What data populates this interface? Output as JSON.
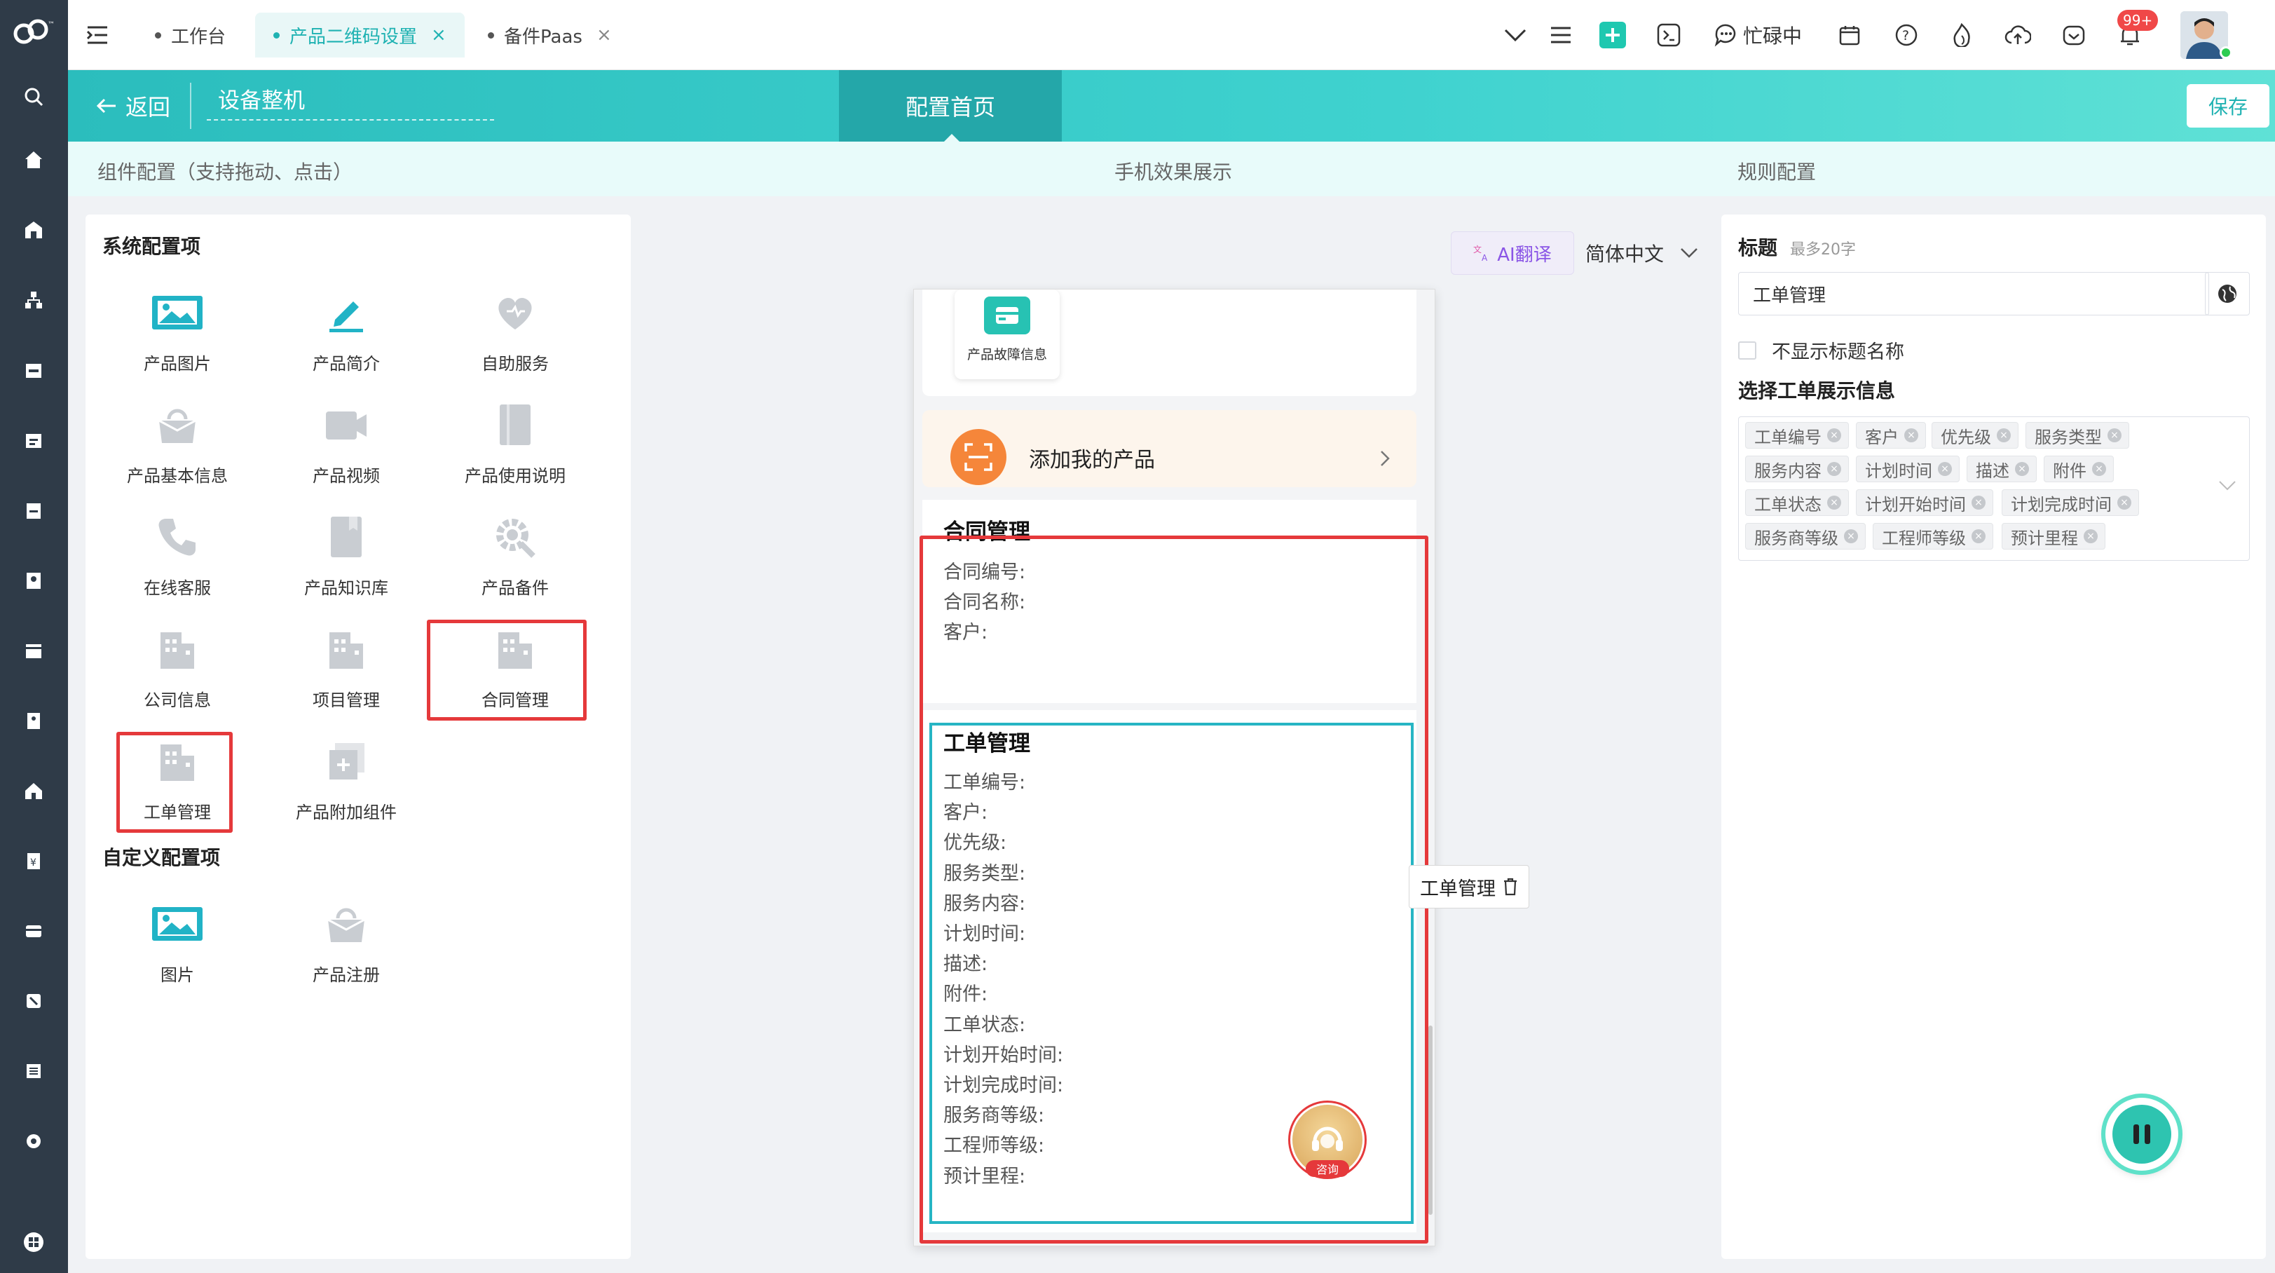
{
  "tabs": [
    {
      "label": "工作台",
      "active": false,
      "closable": false
    },
    {
      "label": "产品二维码设置",
      "active": true,
      "closable": true
    },
    {
      "label": "备件Paas",
      "active": false,
      "closable": true
    }
  ],
  "topbar": {
    "status_label": "忙碌中",
    "notification_badge": "99+",
    "close_glyph": "×"
  },
  "header": {
    "back_label": "返回",
    "page_name": "设备整机",
    "active_tab": "配置首页",
    "save_label": "保存"
  },
  "subheader": {
    "left": "组件配置（支持拖动、点击）",
    "center": "手机效果展示",
    "right": "规则配置"
  },
  "left_panel": {
    "system_title": "系统配置项",
    "system_items": [
      {
        "label": "产品图片",
        "icon": "image-icon"
      },
      {
        "label": "产品简介",
        "icon": "pen-icon"
      },
      {
        "label": "自助服务",
        "icon": "heart-icon"
      },
      {
        "label": "产品基本信息",
        "icon": "bag-icon"
      },
      {
        "label": "产品视频",
        "icon": "video-icon"
      },
      {
        "label": "产品使用说明",
        "icon": "document-icon"
      },
      {
        "label": "在线客服",
        "icon": "phone-icon"
      },
      {
        "label": "产品知识库",
        "icon": "book-icon"
      },
      {
        "label": "产品备件",
        "icon": "gear-icon"
      },
      {
        "label": "公司信息",
        "icon": "building-icon"
      },
      {
        "label": "项目管理",
        "icon": "building-icon"
      },
      {
        "label": "合同管理",
        "icon": "building-icon"
      },
      {
        "label": "工单管理",
        "icon": "building-icon"
      },
      {
        "label": "产品附加组件",
        "icon": "add-component-icon"
      }
    ],
    "custom_title": "自定义配置项",
    "custom_items": [
      {
        "label": "图片",
        "icon": "image-icon"
      },
      {
        "label": "产品注册",
        "icon": "bag-icon"
      }
    ]
  },
  "preview": {
    "ai_translate_label": "AI翻译",
    "language_label": "简体中文",
    "fault_info_label": "产品故障信息",
    "add_product_label": "添加我的产品",
    "contract": {
      "title": "合同管理",
      "fields": [
        "合同编号:",
        "合同名称:",
        "客户:"
      ]
    },
    "work_order": {
      "title": "工单管理",
      "fields": [
        "工单编号:",
        "客户:",
        "优先级:",
        "服务类型:",
        "服务内容:",
        "计划时间:",
        "描述:",
        "附件:",
        "工单状态:",
        "计划开始时间:",
        "计划完成时间:",
        "服务商等级:",
        "工程师等级:",
        "预计里程:"
      ]
    },
    "consult_label": "咨询",
    "floating_label": "工单管理"
  },
  "right_panel": {
    "title_label": "标题",
    "title_hint": "最多20字",
    "title_value": "工单管理",
    "hide_title_label": "不显示标题名称",
    "hide_title_checked": false,
    "display_info_label": "选择工单展示信息",
    "tags": [
      "工单编号",
      "客户",
      "优先级",
      "服务类型",
      "服务内容",
      "计划时间",
      "描述",
      "附件",
      "工单状态",
      "计划开始时间",
      "计划完成时间",
      "服务商等级",
      "工程师等级",
      "预计里程"
    ]
  },
  "colors": {
    "accent": "#1fb2b2",
    "rail": "#2f3b48",
    "highlight_red": "#e5393b",
    "selected_cyan": "#26b5c4",
    "add_product_orange": "#f5863a"
  }
}
